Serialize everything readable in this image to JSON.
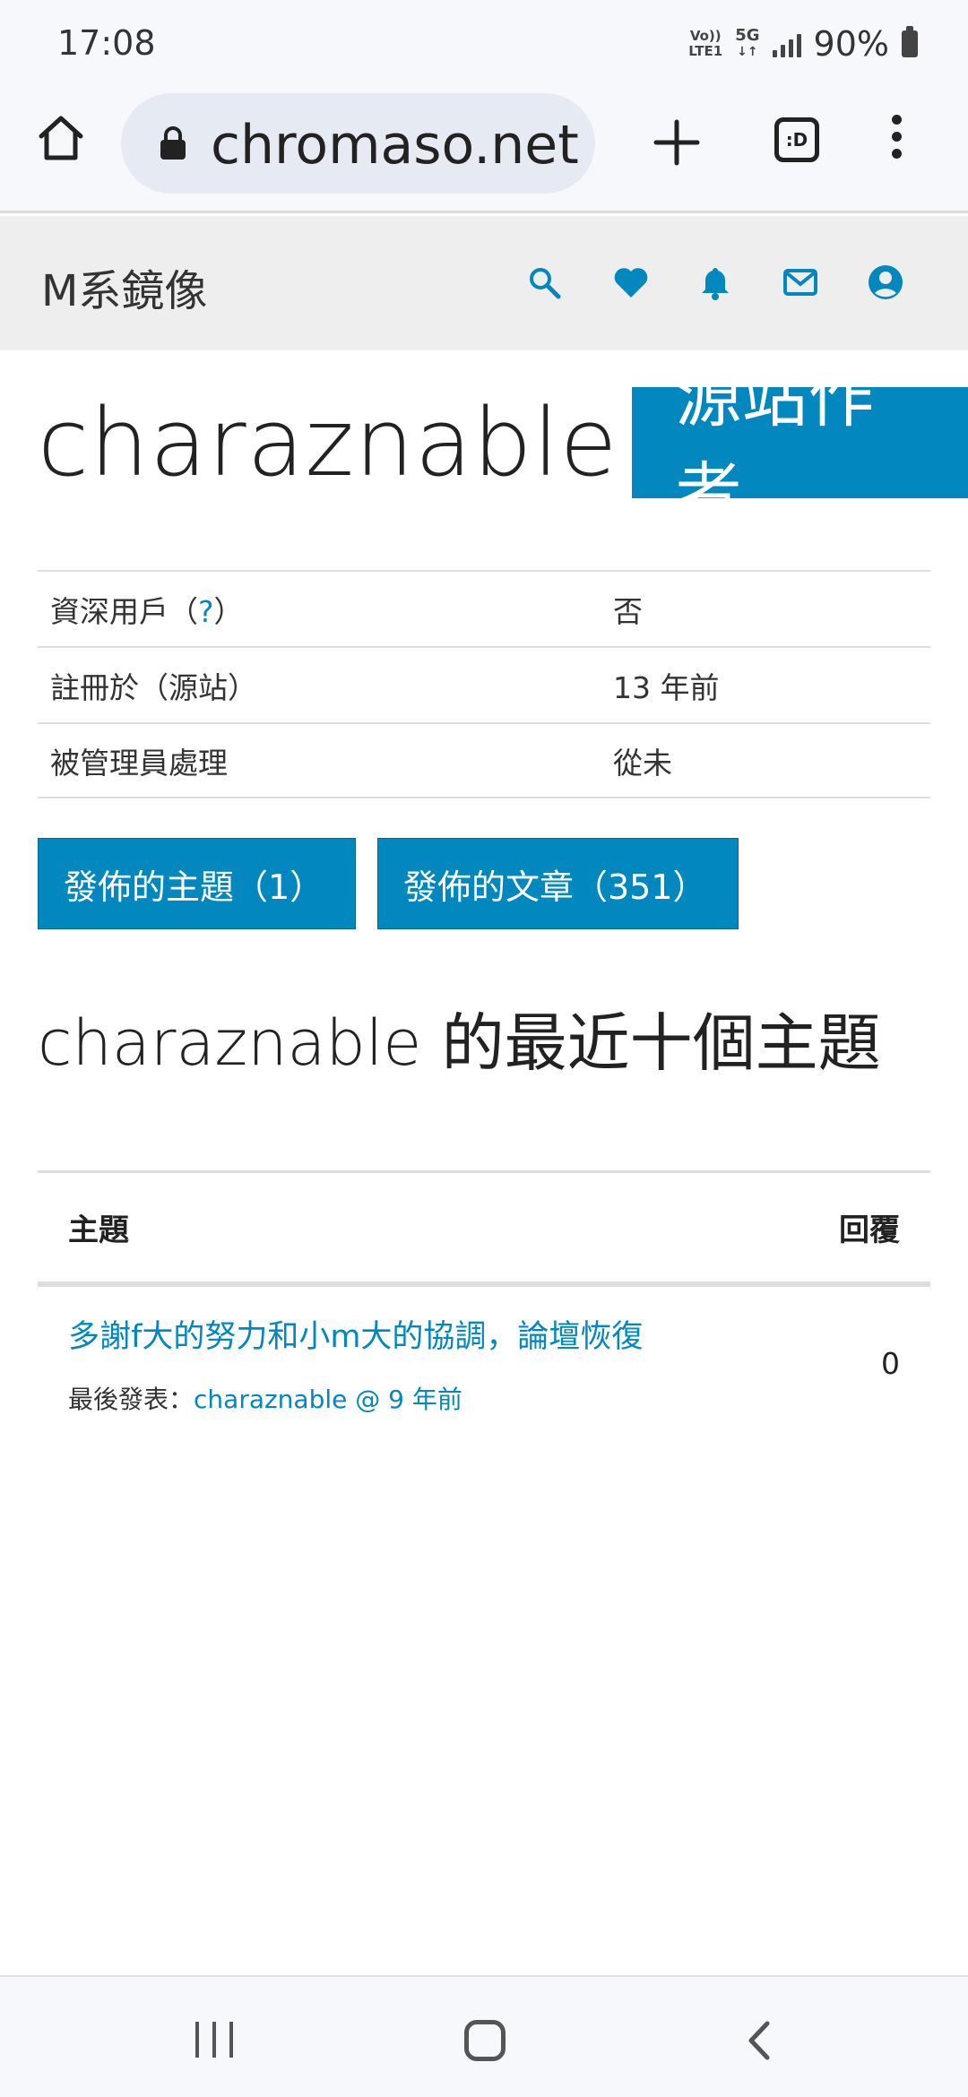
{
  "status_bar": {
    "time": "17:08",
    "volte_top": "Vo))",
    "volte_bottom": "LTE1",
    "network": "5G",
    "battery": "90%"
  },
  "browser": {
    "url": "chromaso.net",
    "tabs_label": ":D",
    "icons": [
      "home-icon",
      "lock-icon",
      "plus-icon",
      "tabs-icon",
      "more-vert-icon"
    ]
  },
  "site": {
    "logo": "M系鏡像",
    "header_icons": [
      "search-icon",
      "heart-icon",
      "bell-icon",
      "mail-icon",
      "account-icon"
    ],
    "accent_color": "#0287be"
  },
  "profile": {
    "username": "charaznable",
    "role_badge": "源站作者",
    "info": [
      {
        "label": "資深用戶（",
        "help": "?",
        "label_end": "）",
        "value": "否"
      },
      {
        "label": "註冊於（源站）",
        "value": "13 年前"
      },
      {
        "label": "被管理員處理",
        "value": "從未"
      }
    ],
    "buttons": {
      "topics": "發佈的主題（1）",
      "posts": "發佈的文章（351）"
    }
  },
  "recent": {
    "title_user": "charaznable",
    "title_rest": " 的最近十個主題",
    "columns": {
      "topic": "主題",
      "replies": "回覆"
    },
    "rows": [
      {
        "title": "多謝f大的努力和小m大的協調，論壇恢復",
        "meta_label": "最後發表：",
        "meta_value": "charaznable @ 9 年前",
        "replies": "0"
      }
    ]
  }
}
